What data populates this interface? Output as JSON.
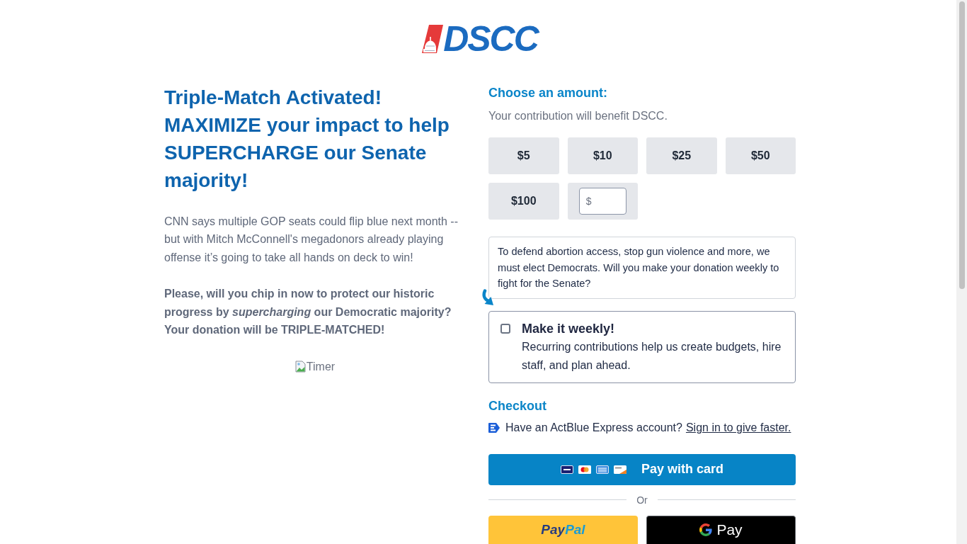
{
  "logo": {
    "text": "DSCC"
  },
  "appeal": {
    "headline": "Triple-Match Activated! MAXIMIZE your impact to help SUPERCHARGE our Senate majority!",
    "paragraphs": [
      {
        "kind": "plain",
        "text": "CNN says multiple GOP seats could flip blue next month -- but with Mitch McConnell's megadonors already playing offense it’s going to take all hands on deck to win!"
      },
      {
        "kind": "bold",
        "text": "Please, will you chip in now to protect our historic progress by *supercharging* our Democratic majority? Your donation will be TRIPLE-MATCHED!"
      }
    ],
    "timer_image": {
      "alt": "Timer"
    }
  },
  "amount": {
    "heading": "Choose an amount:",
    "note": "Your contribution will benefit DSCC.",
    "options": [
      {
        "label": "$5",
        "selected": false
      },
      {
        "label": "$10",
        "selected": false
      },
      {
        "label": "$25",
        "selected": false
      },
      {
        "label": "$50",
        "selected": false
      },
      {
        "label": "$100",
        "selected": false
      }
    ],
    "custom_amount": {
      "prefix": "$"
    }
  },
  "weekly": {
    "prompt": "To defend abortion access, stop gun violence and more, we must elect Democrats. Will you make your donation weekly to fight for the Senate?",
    "checked": false,
    "title": "Make it weekly!",
    "description": "Recurring contributions help us create budgets, hire staff, and plan ahead."
  },
  "checkout": {
    "heading": "Checkout",
    "express_prompt": "Have an ActBlue Express account?",
    "express_link": "Sign in to give faster.",
    "card_button": {
      "label": "Pay with card"
    },
    "divider": "Or",
    "paypal_button": {
      "label": "PayPal"
    },
    "gpay_button": {
      "label": "Pay"
    }
  }
}
